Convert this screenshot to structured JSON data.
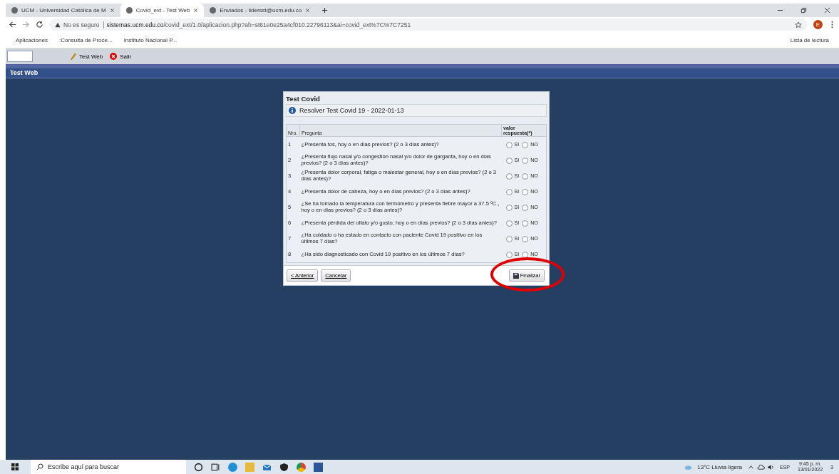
{
  "browser": {
    "tabs": [
      {
        "title": "UCM - Universidad Católica de M",
        "selected": false
      },
      {
        "title": "Covid_ext - Test Web",
        "selected": true
      },
      {
        "title": "Enviados - lidersst@ucm.edu.co",
        "selected": false
      }
    ],
    "security": "No es seguro",
    "url_host": "sistemas.ucm.edu.co",
    "url_path": "/covid_ext/1.0/aplicacion.php?ah=st61e0e25a4cf010.22796113&ai=covid_ext%7C%7C7251",
    "profile": "E",
    "bookmarks": [
      "Aplicaciones",
      ":Consulta de Proce...",
      "Instituto Nacional P..."
    ],
    "reading_list": "Lista de lectura"
  },
  "app": {
    "toolbar": [
      "Test Web",
      "Salir"
    ],
    "title": "Test Web"
  },
  "dialog": {
    "title": "Test Covid",
    "info": "Resolver Test Covid 19 - 2022-01-13",
    "columns": [
      "Nro.",
      "Pregunta",
      "valor respuesta(*)"
    ],
    "rows": [
      {
        "n": "1",
        "q": "¿Presenta tos, hoy o en días previos? (2 o 3 días antes)?",
        "options": [
          {
            "label": "SI",
            "selected": false
          },
          {
            "label": "NO",
            "selected": false
          }
        ]
      },
      {
        "n": "2",
        "q": "¿Presenta flujo nasal y/o congestión nasal y/o dolor de garganta, hoy o en días previos? (2 o 3 días antes)?",
        "options": [
          {
            "label": "SI",
            "selected": false
          },
          {
            "label": "NO",
            "selected": false
          }
        ]
      },
      {
        "n": "3",
        "q": "¿Presenta dolor corporal, fatiga o malestar general, hoy o en días previos? (2 o 3 días antes)?",
        "options": [
          {
            "label": "SI",
            "selected": false
          },
          {
            "label": "NO",
            "selected": false
          }
        ]
      },
      {
        "n": "4",
        "q": "¿Presenta dolor de cabeza, hoy o en días previos? (2 o 3 días antes)?",
        "options": [
          {
            "label": "SI",
            "selected": false
          },
          {
            "label": "NO",
            "selected": false
          }
        ]
      },
      {
        "n": "5",
        "q": "¿Se ha tomado la temperatura con termómetro y presenta fiebre mayor a 37.5 ºC., hoy o en días previos? (2 o 3 días antes)?",
        "options": [
          {
            "label": "SI",
            "selected": false
          },
          {
            "label": "NO",
            "selected": false
          }
        ]
      },
      {
        "n": "6",
        "q": "¿Presenta pérdida del olfato y/o gusto, hoy o en días previos? (2 o 3 días antes)?",
        "options": [
          {
            "label": "SI",
            "selected": false
          },
          {
            "label": "NO",
            "selected": false
          }
        ]
      },
      {
        "n": "7",
        "q": "¿Ha cuidado o ha estado en contacto con paciente Covid 19 positivo en los últimos 7 días?",
        "options": [
          {
            "label": "SI",
            "selected": false
          },
          {
            "label": "NO",
            "selected": false
          }
        ]
      },
      {
        "n": "8",
        "q": "¿Ha sido diagnosticado con Covid 19 positivo en los últimos 7 días?",
        "options": [
          {
            "label": "SI",
            "selected": false
          },
          {
            "label": "NO",
            "selected": false
          }
        ]
      }
    ],
    "buttons": [
      "< Anterior",
      "Cancelar",
      "Finalizar"
    ]
  },
  "taskbar": {
    "search_placeholder": "Escribe aquí para buscar",
    "weather": "13°C  Lluvia ligera",
    "language": "ESP",
    "time": "9:45 p. m.",
    "date": "13/01/2022",
    "notifications": "3"
  }
}
